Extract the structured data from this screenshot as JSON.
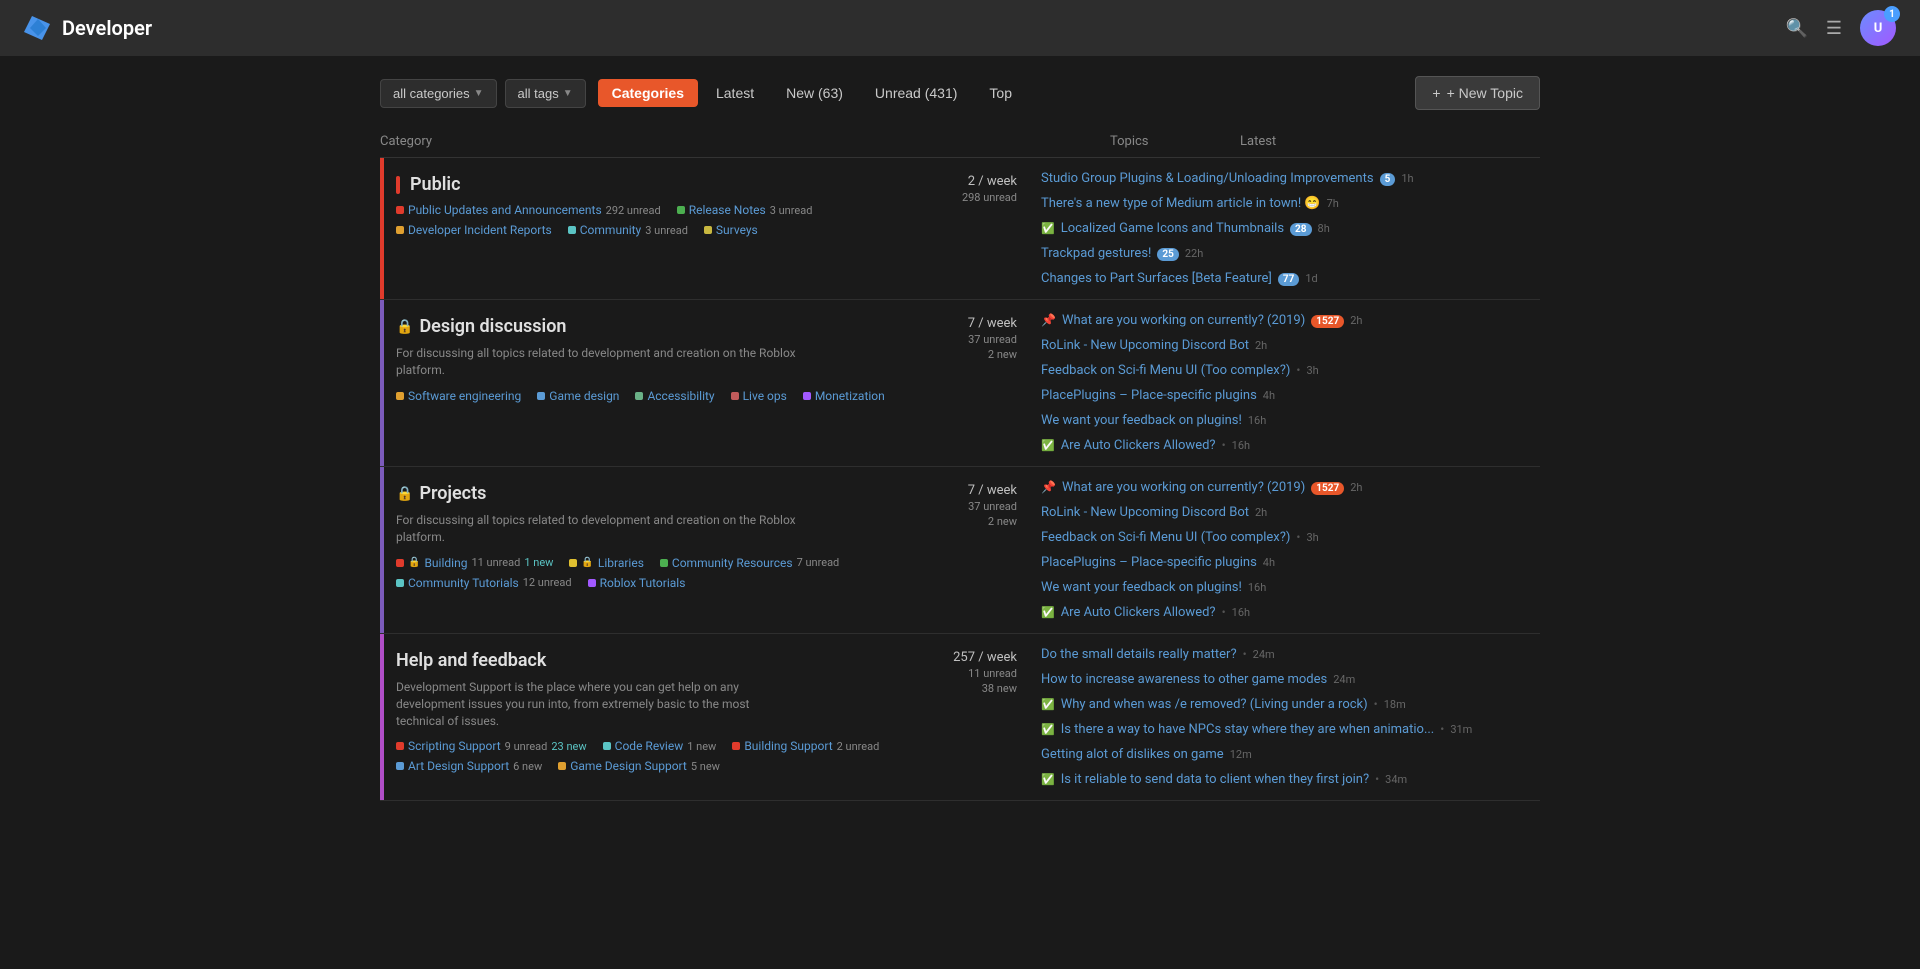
{
  "header": {
    "site_title": "Developer",
    "logo_alt": "developer-logo",
    "avatar_initials": "U",
    "notification_count": "1",
    "search_icon": "🔍",
    "menu_icon": "☰"
  },
  "filters": {
    "categories_label": "all categories",
    "tags_label": "all tags",
    "nav_tabs": [
      {
        "id": "categories",
        "label": "Categories",
        "active": true
      },
      {
        "id": "latest",
        "label": "Latest",
        "active": false
      },
      {
        "id": "new",
        "label": "New (63)",
        "active": false
      },
      {
        "id": "unread",
        "label": "Unread (431)",
        "active": false
      },
      {
        "id": "top",
        "label": "Top",
        "active": false
      }
    ],
    "new_topic_label": "+ New Topic"
  },
  "table_headers": {
    "category": "Category",
    "topics": "Topics",
    "latest": "Latest"
  },
  "sections": [
    {
      "id": "public",
      "name": "Public",
      "color_class": "public",
      "locked": false,
      "description": "",
      "subcategories": [
        {
          "color": "#e03b2c",
          "label": "Public Updates and Announcements",
          "count": "292",
          "count_label": "unread",
          "locked": false
        },
        {
          "color": "#4caf50",
          "label": "Release Notes",
          "count": "3",
          "count_label": "unread",
          "locked": false
        },
        {
          "color": "#e0a030",
          "label": "Developer Incident Reports",
          "count": "",
          "count_label": "",
          "locked": false
        },
        {
          "color": "#5bc4c4",
          "label": "Community",
          "count": "3",
          "count_label": "unread",
          "locked": false
        },
        {
          "color": "#e0c030",
          "label": "Surveys",
          "count": "",
          "count_label": "",
          "locked": false
        }
      ],
      "stats": {
        "per_week": "2",
        "unread": "298 unread",
        "new": ""
      },
      "topics": [
        {
          "pin": false,
          "solved": false,
          "text": "Studio Group Plugins & Loading/Unloading Improvements",
          "badge": "5",
          "time": "1h"
        },
        {
          "pin": false,
          "solved": false,
          "text": "There's a new type of Medium article in town! 😁",
          "badge": "",
          "time": "7h"
        },
        {
          "pin": false,
          "solved": true,
          "text": "Localized Game Icons and Thumbnails",
          "badge": "28",
          "time": "8h"
        },
        {
          "pin": false,
          "solved": false,
          "text": "Trackpad gestures!",
          "badge": "25",
          "time": "22h"
        },
        {
          "pin": false,
          "solved": false,
          "text": "Changes to Part Surfaces [Beta Feature]",
          "badge": "77",
          "time": "1d"
        }
      ]
    },
    {
      "id": "design",
      "name": "Design discussion",
      "color_class": "design",
      "locked": true,
      "description": "For discussing all topics related to development and creation on the Roblox platform.",
      "subcategories": [
        {
          "color": "#e0a030",
          "label": "Software engineering",
          "count": "",
          "count_label": "",
          "locked": false
        },
        {
          "color": "#5b9bd5",
          "label": "Game design",
          "count": "",
          "count_label": "",
          "locked": false
        },
        {
          "color": "#6ab187",
          "label": "Accessibility",
          "count": "",
          "count_label": "",
          "locked": false
        },
        {
          "color": "#c05b5b",
          "label": "Live ops",
          "count": "",
          "count_label": "",
          "locked": false
        },
        {
          "color": "#a259ff",
          "label": "Monetization",
          "count": "",
          "count_label": "",
          "locked": false
        }
      ],
      "stats": {
        "per_week": "7",
        "unread": "37 unread",
        "new": "2 new"
      },
      "topics": [
        {
          "pin": true,
          "solved": false,
          "text": "What are you working on currently? (2019)",
          "badge": "1527",
          "badge_color": "orange",
          "time": "2h"
        },
        {
          "pin": false,
          "solved": false,
          "text": "RoLink - New Upcoming Discord Bot",
          "badge": "",
          "time": "2h"
        },
        {
          "pin": false,
          "solved": false,
          "text": "Feedback on Sci-fi Menu UI (Too complex?)",
          "badge": "",
          "time": "3h",
          "dot": true
        },
        {
          "pin": false,
          "solved": false,
          "text": "PlacePlugins – Place-specific plugins",
          "badge": "",
          "time": "4h"
        },
        {
          "pin": false,
          "solved": false,
          "text": "We want your feedback on plugins!",
          "badge": "",
          "time": "16h"
        },
        {
          "pin": false,
          "solved": true,
          "text": "Are Auto Clickers Allowed?",
          "badge": "",
          "time": "16h",
          "dot": true
        }
      ]
    },
    {
      "id": "projects",
      "name": "Projects",
      "color_class": "projects",
      "locked": true,
      "description": "For discussing all topics related to development and creation on the Roblox platform.",
      "subcategories": [
        {
          "color": "#e03b2c",
          "label": "Building",
          "count": "11",
          "count_label": "unread",
          "new": "1 new",
          "locked": true
        },
        {
          "color": "#e0c030",
          "label": "Libraries",
          "count": "",
          "count_label": "",
          "locked": true
        },
        {
          "color": "#4caf50",
          "label": "Community Resources",
          "count": "7",
          "count_label": "unread",
          "locked": false
        },
        {
          "color": "#5bc4c4",
          "label": "Community Tutorials",
          "count": "12",
          "count_label": "unread",
          "locked": false
        },
        {
          "color": "#a259ff",
          "label": "Roblox Tutorials",
          "count": "",
          "count_label": "",
          "locked": false
        }
      ],
      "stats": {
        "per_week": "7",
        "unread": "37 unread",
        "new": "2 new"
      },
      "topics": [
        {
          "pin": true,
          "solved": false,
          "text": "What are you working on currently? (2019)",
          "badge": "1527",
          "badge_color": "orange",
          "time": "2h"
        },
        {
          "pin": false,
          "solved": false,
          "text": "RoLink - New Upcoming Discord Bot",
          "badge": "",
          "time": "2h"
        },
        {
          "pin": false,
          "solved": false,
          "text": "Feedback on Sci-fi Menu UI (Too complex?)",
          "badge": "",
          "time": "3h",
          "dot": true
        },
        {
          "pin": false,
          "solved": false,
          "text": "PlacePlugins – Place-specific plugins",
          "badge": "",
          "time": "4h"
        },
        {
          "pin": false,
          "solved": false,
          "text": "We want your feedback on plugins!",
          "badge": "",
          "time": "16h"
        },
        {
          "pin": false,
          "solved": true,
          "text": "Are Auto Clickers Allowed?",
          "badge": "",
          "time": "16h",
          "dot": true
        }
      ]
    },
    {
      "id": "help",
      "name": "Help and feedback",
      "color_class": "help",
      "locked": false,
      "description": "Development Support is the place where you can get help on any development issues you run into, from extremely basic to the most technical of issues.",
      "subcategories": [
        {
          "color": "#e03b2c",
          "label": "Scripting Support",
          "count": "9",
          "count_label": "unread",
          "new": "23 new",
          "locked": false
        },
        {
          "color": "#5bc4c4",
          "label": "Code Review",
          "count": "1",
          "count_label": "new",
          "locked": false
        },
        {
          "color": "#e03b2c",
          "label": "Building Support",
          "count": "2",
          "count_label": "unread",
          "new": "",
          "locked": false
        },
        {
          "color": "#5b9bd5",
          "label": "Art Design Support",
          "count": "6",
          "count_label": "new",
          "locked": false
        },
        {
          "color": "#e0a030",
          "label": "Game Design Support",
          "count": "5",
          "count_label": "new",
          "locked": false
        }
      ],
      "stats": {
        "per_week": "257",
        "unread": "11 unread",
        "new": "38 new"
      },
      "topics": [
        {
          "pin": false,
          "solved": false,
          "text": "Do the small details really matter?",
          "badge": "",
          "time": "24m",
          "dot": true
        },
        {
          "pin": false,
          "solved": false,
          "text": "How to increase awareness to other game modes",
          "badge": "",
          "time": "24m"
        },
        {
          "pin": false,
          "solved": true,
          "text": "Why and when was /e removed? (Living under a rock)",
          "badge": "",
          "time": "18m",
          "dot": true
        },
        {
          "pin": false,
          "solved": true,
          "text": "Is there a way to have NPCs stay where they are when animatio...",
          "badge": "",
          "time": "31m",
          "dot": true
        },
        {
          "pin": false,
          "solved": false,
          "text": "Getting alot of dislikes on game",
          "badge": "",
          "time": "12m"
        },
        {
          "pin": false,
          "solved": true,
          "text": "Is it reliable to send data to client when they first join?",
          "badge": "",
          "time": "34m",
          "dot": true
        }
      ]
    }
  ]
}
